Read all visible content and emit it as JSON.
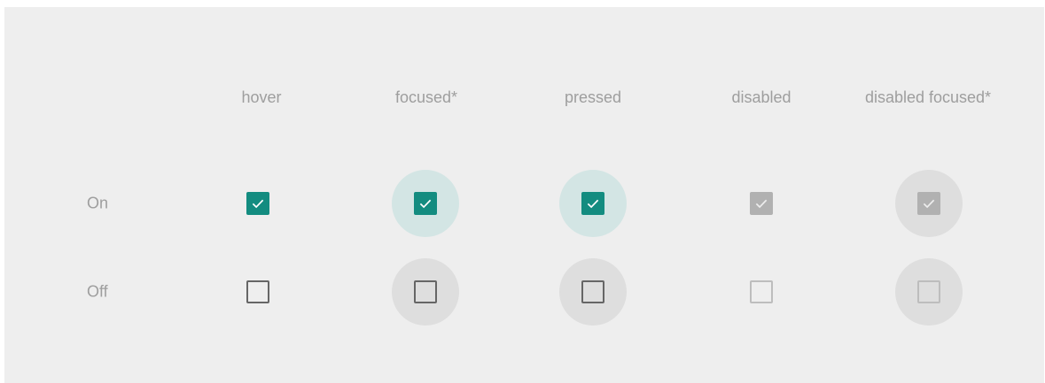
{
  "columns": [
    "hover",
    "focused*",
    "pressed",
    "disabled",
    "disabled focused*"
  ],
  "rows": [
    "On",
    "Off"
  ],
  "colors": {
    "accent": "#138c80",
    "focus_halo_on": "#d3e5e4",
    "focus_halo_off": "#dedede",
    "disabled_fill": "#b1b1b1",
    "unchecked_border": "#666666",
    "disabled_border": "#bdbdbd",
    "label_text": "#9e9e9e",
    "panel_background": "#eeeeee"
  },
  "checkboxes": {
    "on": [
      {
        "state": "hover",
        "checked": true,
        "disabled": false,
        "halo": false
      },
      {
        "state": "focused",
        "checked": true,
        "disabled": false,
        "halo": true
      },
      {
        "state": "pressed",
        "checked": true,
        "disabled": false,
        "halo": true
      },
      {
        "state": "disabled",
        "checked": true,
        "disabled": true,
        "halo": false
      },
      {
        "state": "disabled focused",
        "checked": true,
        "disabled": true,
        "halo": true
      }
    ],
    "off": [
      {
        "state": "hover",
        "checked": false,
        "disabled": false,
        "halo": false
      },
      {
        "state": "focused",
        "checked": false,
        "disabled": false,
        "halo": true
      },
      {
        "state": "pressed",
        "checked": false,
        "disabled": false,
        "halo": true
      },
      {
        "state": "disabled",
        "checked": false,
        "disabled": true,
        "halo": false
      },
      {
        "state": "disabled focused",
        "checked": false,
        "disabled": true,
        "halo": true
      }
    ]
  },
  "icons": {
    "check": "check-icon"
  }
}
